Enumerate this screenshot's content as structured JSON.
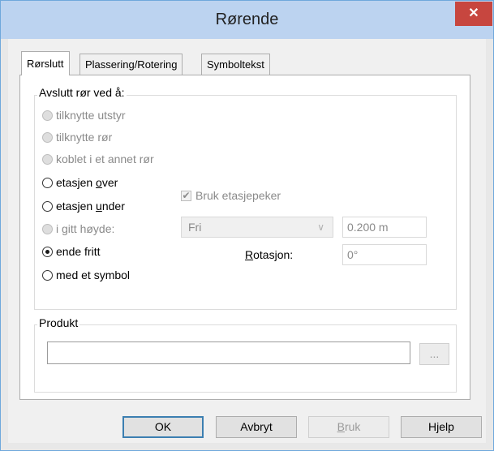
{
  "window": {
    "title": "Rørende",
    "close_glyph": "✕"
  },
  "tabs": [
    {
      "label": "Rørslutt",
      "active": true
    },
    {
      "label": "Plassering/Rotering",
      "active": false
    },
    {
      "label": "Symboltekst",
      "active": false
    }
  ],
  "end_group": {
    "label": "Avslutt rør ved å:",
    "options": [
      {
        "label": "tilknytte utstyr",
        "enabled": false,
        "checked": false
      },
      {
        "label": "tilknytte rør",
        "enabled": false,
        "checked": false
      },
      {
        "label": "koblet i et annet rør",
        "enabled": false,
        "checked": false
      },
      {
        "label_pre": "etasjen ",
        "label_u": "o",
        "label_post": "ver",
        "enabled": true,
        "checked": false
      },
      {
        "label_pre": "etasjen ",
        "label_u": "u",
        "label_post": "nder",
        "enabled": true,
        "checked": false
      },
      {
        "label_pre": "i ",
        "label_u": "g",
        "label_post": "itt høyde:",
        "enabled": false,
        "checked": false
      },
      {
        "label": "ende fritt",
        "enabled": true,
        "checked": true
      },
      {
        "label": "med et symbol",
        "enabled": true,
        "checked": false
      }
    ],
    "floor_pointer": {
      "label": "Bruk etasjepeker",
      "checked": true,
      "enabled": false
    },
    "height_mode": {
      "value": "Fri"
    },
    "height_value": "0.200 m",
    "rotation": {
      "label_u": "R",
      "label_rest": "otasjon:",
      "value": "0°"
    }
  },
  "product_group": {
    "label": "Produkt",
    "value": "",
    "browse_label": "..."
  },
  "buttons": {
    "ok": "OK",
    "cancel": "Avbryt",
    "apply_u": "B",
    "apply_rest": "ruk",
    "help": "Hjelp"
  }
}
